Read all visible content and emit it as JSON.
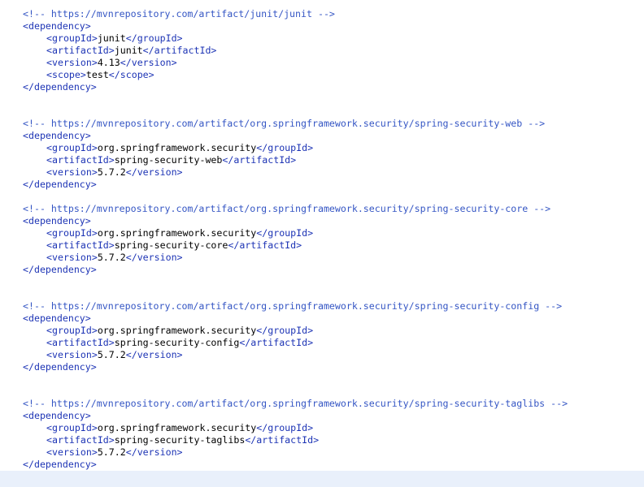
{
  "blocks": [
    {
      "comment": "<!-- https://mvnrepository.com/artifact/junit/junit -->",
      "open": "<dependency>",
      "close": "</dependency>",
      "fields": [
        {
          "open": "<groupId>",
          "value": "junit",
          "close": "</groupId>"
        },
        {
          "open": "<artifactId>",
          "value": "junit",
          "close": "</artifactId>"
        },
        {
          "open": "<version>",
          "value": "4.13",
          "close": "</version>"
        },
        {
          "open": "<scope>",
          "value": "test",
          "close": "</scope>"
        }
      ]
    },
    {
      "comment": "<!-- https://mvnrepository.com/artifact/org.springframework.security/spring-security-web -->",
      "open": "<dependency>",
      "close": "</dependency>",
      "fields": [
        {
          "open": "<groupId>",
          "value": "org.springframework.security",
          "close": "</groupId>"
        },
        {
          "open": "<artifactId>",
          "value": "spring-security-web",
          "close": "</artifactId>"
        },
        {
          "open": "<version>",
          "value": "5.7.2",
          "close": "</version>"
        }
      ]
    },
    {
      "comment": "<!-- https://mvnrepository.com/artifact/org.springframework.security/spring-security-core -->",
      "open": "<dependency>",
      "close": "</dependency>",
      "fields": [
        {
          "open": "<groupId>",
          "value": "org.springframework.security",
          "close": "</groupId>"
        },
        {
          "open": "<artifactId>",
          "value": "spring-security-core",
          "close": "</artifactId>"
        },
        {
          "open": "<version>",
          "value": "5.7.2",
          "close": "</version>"
        }
      ]
    },
    {
      "comment": "<!-- https://mvnrepository.com/artifact/org.springframework.security/spring-security-config -->",
      "open": "<dependency>",
      "close": "</dependency>",
      "fields": [
        {
          "open": "<groupId>",
          "value": "org.springframework.security",
          "close": "</groupId>"
        },
        {
          "open": "<artifactId>",
          "value": "spring-security-config",
          "close": "</artifactId>"
        },
        {
          "open": "<version>",
          "value": "5.7.2",
          "close": "</version>"
        }
      ]
    },
    {
      "comment": "<!-- https://mvnrepository.com/artifact/org.springframework.security/spring-security-taglibs -->",
      "open": "<dependency>",
      "close": "</dependency>",
      "fields": [
        {
          "open": "<groupId>",
          "value": "org.springframework.security",
          "close": "</groupId>"
        },
        {
          "open": "<artifactId>",
          "value": "spring-security-taglibs",
          "close": "</artifactId>"
        },
        {
          "open": "<version>",
          "value": "5.7.2",
          "close": "</version>"
        }
      ]
    }
  ],
  "colors": {
    "tag": "#1d34b5",
    "comment": "#3556c4",
    "value": "#000000",
    "strip": "#e9f0fb"
  }
}
